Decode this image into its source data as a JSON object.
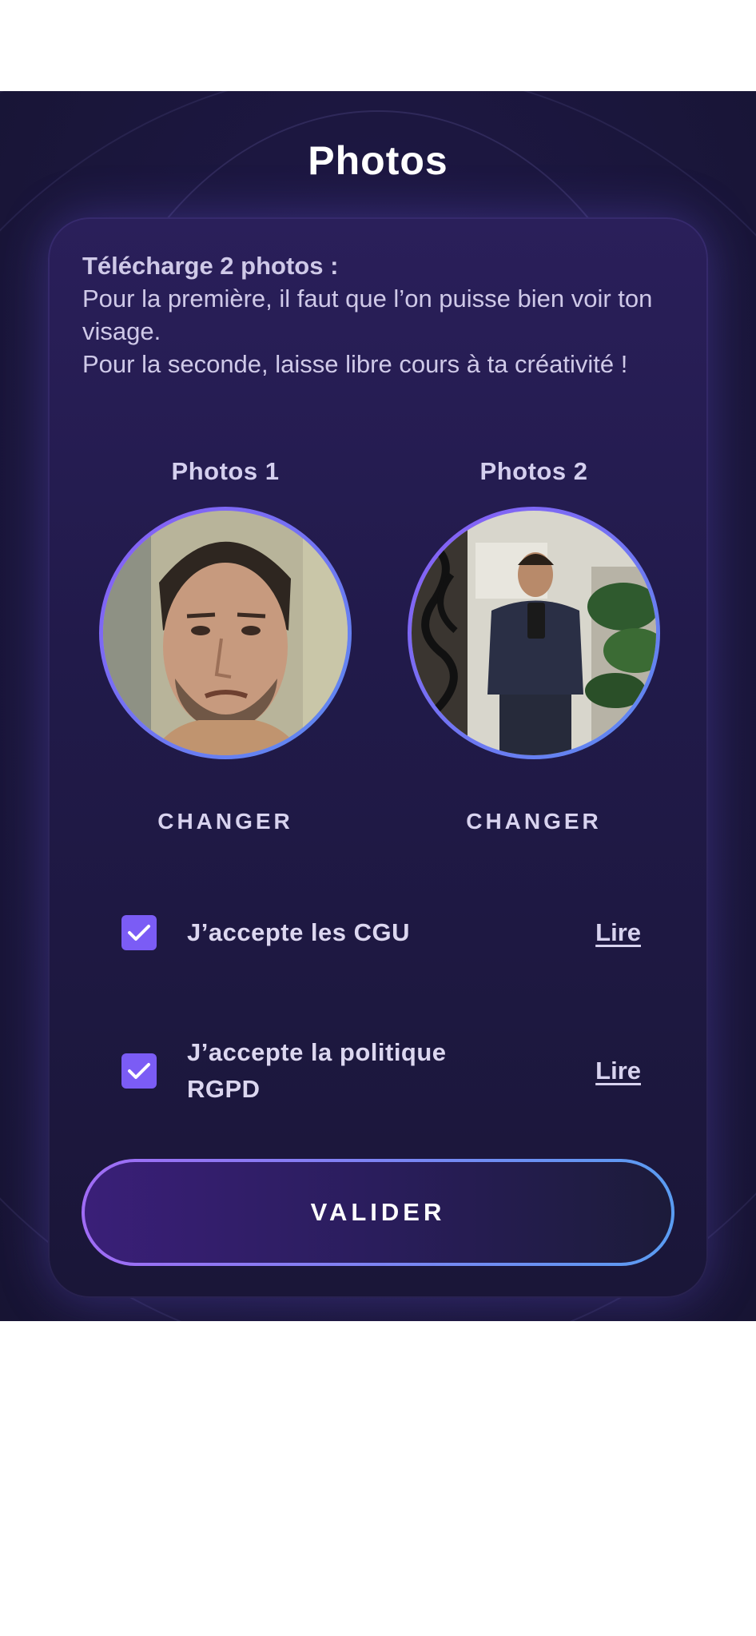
{
  "header": {
    "title": "Photos"
  },
  "intro": {
    "heading": "Télécharge 2 photos :",
    "line1": "Pour la première, il faut que l’on puisse bien voir ton visage.",
    "line2": "Pour la seconde, laisse libre cours à ta créativité !"
  },
  "photos": [
    {
      "label": "Photos 1",
      "change_label": "CHANGER"
    },
    {
      "label": "Photos 2",
      "change_label": "CHANGER"
    }
  ],
  "consents": [
    {
      "label": "J’accepte les CGU",
      "checked": true,
      "link_label": "Lire"
    },
    {
      "label": "J’accepte la politique RGPD",
      "checked": true,
      "link_label": "Lire"
    }
  ],
  "submit": {
    "label": "VALIDER"
  },
  "colors": {
    "accent": "#7b5cf5",
    "background": "#1c1740",
    "card": "#221a4c",
    "gradient_start": "#a06cf5",
    "gradient_end": "#5a9cf2"
  }
}
